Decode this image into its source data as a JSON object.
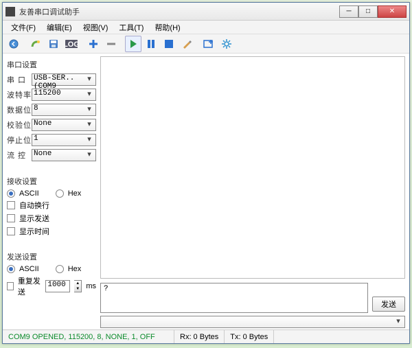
{
  "titlebar": {
    "title": "友善串口调试助手"
  },
  "menu": {
    "file": "文件(F)",
    "edit": "编辑(E)",
    "view": "视图(V)",
    "tool": "工具(T)",
    "help": "帮助(H)"
  },
  "serial": {
    "title": "串口设置",
    "port_label": "串  口",
    "port_value": "USB-SER..(COM9",
    "baud_label": "波特率",
    "baud_value": "115200",
    "databits_label": "数据位",
    "databits_value": "8",
    "parity_label": "校验位",
    "parity_value": "None",
    "stopbits_label": "停止位",
    "stopbits_value": "1",
    "flow_label": "流  控",
    "flow_value": "None"
  },
  "recv": {
    "title": "接收设置",
    "ascii": "ASCII",
    "hex": "Hex",
    "wrap": "自动换行",
    "show_send": "显示发送",
    "show_time": "显示时间"
  },
  "send": {
    "title": "发送设置",
    "ascii": "ASCII",
    "hex": "Hex",
    "repeat": "重复发送",
    "interval": "1000",
    "unit": "ms"
  },
  "tx_text": "?",
  "send_btn": "发送",
  "status": {
    "conn": "COM9 OPENED, 115200, 8, NONE, 1, OFF",
    "rx": "Rx: 0 Bytes",
    "tx": "Tx: 0 Bytes"
  }
}
